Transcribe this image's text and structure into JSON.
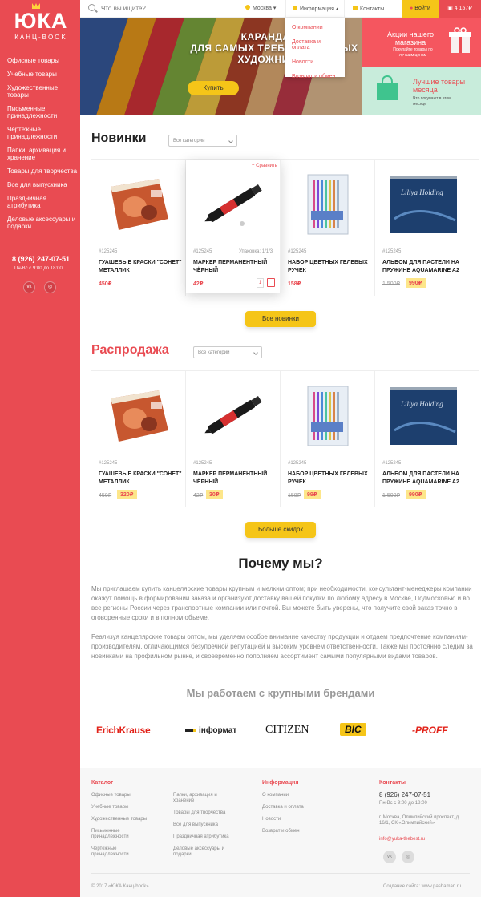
{
  "logo": {
    "main": "ЮКА",
    "sub": "КАНЦ-BOOK"
  },
  "sidebar": {
    "items": [
      {
        "label": "Офисные товары"
      },
      {
        "label": "Учебные товары"
      },
      {
        "label": "Художественные товары"
      },
      {
        "label": "Письменные принадлежности"
      },
      {
        "label": "Чертежные принадлежности"
      },
      {
        "label": "Папки, архивация и хранение"
      },
      {
        "label": "Товары для творчества"
      },
      {
        "label": "Все для выпускника"
      },
      {
        "label": "Праздничная атрибутика"
      },
      {
        "label": "Деловые аксессуары и подарки"
      }
    ],
    "phone": "8 (926) 247-07-51",
    "hours": "Пн-Вс с 9:00 до 18:00"
  },
  "topbar": {
    "search_placeholder": "Что вы ищите?",
    "city": "Москва",
    "info": "Информация",
    "contacts": "Контакты",
    "login": "Войти",
    "cart_total": "4 157₽"
  },
  "dropdown": {
    "items": [
      {
        "label": "О компании"
      },
      {
        "label": "Доставка и оплата"
      },
      {
        "label": "Новости"
      },
      {
        "label": "Возврат и обмен"
      }
    ]
  },
  "hero": {
    "line1": "КАРАНДАШИ",
    "line2": "ДЛЯ САМЫХ ТРЕБОВАТЕЛЬНЫХ",
    "line3": "ХУДОЖНИКОВ",
    "button": "Купить"
  },
  "promo1": {
    "title": "Акции нашего магазина",
    "text": "Покупайте товары по лучшим ценам"
  },
  "promo2": {
    "title": "Лучшие товары месяца",
    "text": "Что покупают в этом месяце"
  },
  "new_section": {
    "title": "Новинки",
    "category": "Все категории",
    "compare": "+ Сравнить",
    "pack": "Упаковка: 1/1/3",
    "qty": "1",
    "products": [
      {
        "sku": "#125245",
        "name": "ГУАШЕВЫЕ КРАСКИ \"СОНЕТ\" МЕТАЛЛИК",
        "price": "450₽"
      },
      {
        "sku": "#125245",
        "name": "МАРКЕР ПЕРМАНЕНТНЫЙ ЧЁРНЫЙ",
        "price": "42₽"
      },
      {
        "sku": "#125245",
        "name": "НАБОР ЦВЕТНЫХ ГЕЛЕВЫХ РУЧЕК",
        "price": "158₽"
      },
      {
        "sku": "#125245",
        "name": "АЛЬБОМ ДЛЯ ПАСТЕЛИ НА ПРУЖИНЕ AQUAMARINE A2",
        "old": "1 500₽",
        "new": "990₽"
      }
    ],
    "button": "Все новинки"
  },
  "sale_section": {
    "title": "Распродажа",
    "category": "Все категории",
    "products": [
      {
        "sku": "#125245",
        "name": "ГУАШЕВЫЕ КРАСКИ \"СОНЕТ\" МЕТАЛЛИК",
        "old": "450₽",
        "new": "320₽"
      },
      {
        "sku": "#125245",
        "name": "МАРКЕР ПЕРМАНЕНТНЫЙ ЧЁРНЫЙ",
        "old": "42₽",
        "new": "30₽"
      },
      {
        "sku": "#125245",
        "name": "НАБОР ЦВЕТНЫХ ГЕЛЕВЫХ РУЧЕК",
        "old": "158₽",
        "new": "99₽"
      },
      {
        "sku": "#125245",
        "name": "АЛЬБОМ ДЛЯ ПАСТЕЛИ НА ПРУЖИНЕ AQUAMARINE A2",
        "old": "1 500₽",
        "new": "990₽"
      }
    ],
    "button": "Больше скидок"
  },
  "why": {
    "title": "Почему мы?",
    "p1": "Мы приглашаем купить канцелярские товары крупным и мелким оптом; при необходимости, консультант-менеджеры компании окажут помощь в формировании заказа и организуют доставку вашей покупки по любому адресу в Москве, Подмосковью и во все регионы России через транспортные компании или почтой. Вы можете быть уверены, что получите свой заказ точно в оговоренные сроки и в полном объеме.",
    "p2": "Реализуя канцелярские товары оптом, мы уделяем особое внимание качеству продукции и отдаем предпочтение компаниям-производителям, отличающимся безупречной репутацией и высоким уровнем ответственности. Также мы постоянно следим за новинками на профильном рынке, и своевременно пополняем ассортимент самыми популярными видами товаров."
  },
  "brands": {
    "title": "Мы работаем с крупными брендами",
    "items": [
      {
        "label": "ErichKrause"
      },
      {
        "label": "інформат"
      },
      {
        "label": "CITIZEN"
      },
      {
        "label": "BIC"
      },
      {
        "label": "-PROFF"
      }
    ]
  },
  "footer": {
    "catalog_title": "Каталог",
    "catalog_col1": [
      {
        "label": "Офисные товары"
      },
      {
        "label": "Учебные товары"
      },
      {
        "label": "Художественные товары"
      },
      {
        "label": "Письменные принадлежности"
      },
      {
        "label": "Чертежные принадлежности"
      }
    ],
    "catalog_col2": [
      {
        "label": "Папки, архивация и хранение"
      },
      {
        "label": "Товары для творчества"
      },
      {
        "label": "Все для выпускника"
      },
      {
        "label": "Праздничная атрибутика"
      },
      {
        "label": "Деловые аксессуары и подарки"
      }
    ],
    "info_title": "Информация",
    "info_links": [
      {
        "label": "О компании"
      },
      {
        "label": "Доставка и оплата"
      },
      {
        "label": "Новости"
      },
      {
        "label": "Возврат и обмен"
      }
    ],
    "contacts_title": "Контакты",
    "phone": "8 (926) 247-07-51",
    "hours": "Пн-Вс с 9:00 до 18:00",
    "address": "г. Москва, Олимпийский проспект, д. 16/1, СК «Олимпийский»",
    "email": "info@yuka-thebest.ru",
    "copyright": "© 2017 «ЮКА Канц-book»",
    "credit": "Создание сайта: www.pashaman.ru"
  },
  "colors": {
    "accent": "#e94b52",
    "yellow": "#f5c518"
  }
}
